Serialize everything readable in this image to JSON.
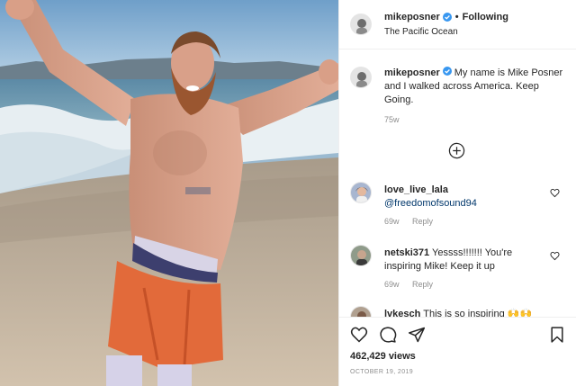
{
  "header": {
    "username": "mikeposner",
    "separator": "•",
    "follow_status": "Following",
    "location": "The Pacific Ocean"
  },
  "caption": {
    "username": "mikeposner",
    "text": "My name is Mike Posner and I walked across America. Keep Going.",
    "age": "75w"
  },
  "comments": [
    {
      "username": "love_live_lala",
      "text": "@freedomofsound94",
      "age": "69w",
      "reply_label": "Reply"
    },
    {
      "username": "netski371",
      "text": "Yessss!!!!!!! You're inspiring Mike! Keep it up",
      "age": "69w",
      "reply_label": "Reply"
    },
    {
      "username": "lvkesch",
      "text": "This is so inspiring 🙌🙌"
    }
  ],
  "stats": {
    "views": "462,429 views",
    "date": "OCTOBER 19, 2019"
  },
  "icons": {
    "verified": "verified-badge-icon",
    "load_more": "plus-circle-icon",
    "like": "heart-icon",
    "comment": "comment-icon",
    "share": "paper-plane-icon",
    "save": "bookmark-icon"
  },
  "colors": {
    "verified_blue": "#3897f0",
    "mention_blue": "#00376b",
    "muted_text": "#8e8e8e"
  }
}
